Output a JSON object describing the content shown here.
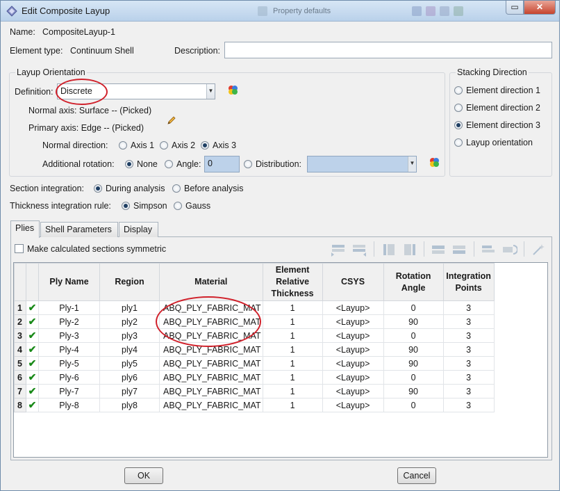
{
  "window": {
    "title": "Edit Composite Layup",
    "background_hint": "Property defaults"
  },
  "name": {
    "label": "Name:",
    "value": "CompositeLayup-1"
  },
  "element_type": {
    "label": "Element type:",
    "value": "Continuum Shell"
  },
  "description": {
    "label": "Description:",
    "value": ""
  },
  "layup_orientation": {
    "title": "Layup Orientation",
    "definition_label": "Definition:",
    "definition_value": "Discrete",
    "normal_axis": "Normal axis: Surface -- (Picked)",
    "primary_axis": "Primary axis: Edge -- (Picked)",
    "normal_direction_label": "Normal direction:",
    "normal_direction_options": [
      "Axis 1",
      "Axis 2",
      "Axis 3"
    ],
    "normal_direction_selected": "Axis 3",
    "additional_rotation_label": "Additional rotation:",
    "rotation_none": "None",
    "rotation_angle": "Angle:",
    "rotation_angle_value": "0",
    "rotation_distribution": "Distribution:"
  },
  "stacking_direction": {
    "title": "Stacking Direction",
    "options": [
      "Element direction 1",
      "Element direction 2",
      "Element direction 3",
      "Layup orientation"
    ],
    "selected": "Element direction 3"
  },
  "section_integration": {
    "label": "Section integration:",
    "during": "During analysis",
    "before": "Before analysis"
  },
  "thickness_rule": {
    "label": "Thickness integration rule:",
    "simpson": "Simpson",
    "gauss": "Gauss"
  },
  "tabs": [
    "Plies",
    "Shell Parameters",
    "Display"
  ],
  "symmetric_label": "Make calculated sections symmetric",
  "table": {
    "headers": {
      "ply_name": "Ply Name",
      "region": "Region",
      "material": "Material",
      "thickness": [
        "Element",
        "Relative",
        "Thickness"
      ],
      "csys": "CSYS",
      "rotation": [
        "Rotation",
        "Angle"
      ],
      "integration": [
        "Integration",
        "Points"
      ]
    },
    "rows": [
      {
        "num": "1",
        "ply": "Ply-1",
        "region": "ply1",
        "material": "ABQ_PLY_FABRIC_MAT",
        "thickness": "1",
        "csys": "<Layup>",
        "angle": "0",
        "points": "3"
      },
      {
        "num": "2",
        "ply": "Ply-2",
        "region": "ply2",
        "material": "ABQ_PLY_FABRIC_MAT",
        "thickness": "1",
        "csys": "<Layup>",
        "angle": "90",
        "points": "3"
      },
      {
        "num": "3",
        "ply": "Ply-3",
        "region": "ply3",
        "material": "ABQ_PLY_FABRIC_MAT",
        "thickness": "1",
        "csys": "<Layup>",
        "angle": "0",
        "points": "3"
      },
      {
        "num": "4",
        "ply": "Ply-4",
        "region": "ply4",
        "material": "ABQ_PLY_FABRIC_MAT",
        "thickness": "1",
        "csys": "<Layup>",
        "angle": "90",
        "points": "3"
      },
      {
        "num": "5",
        "ply": "Ply-5",
        "region": "ply5",
        "material": "ABQ_PLY_FABRIC_MAT",
        "thickness": "1",
        "csys": "<Layup>",
        "angle": "90",
        "points": "3"
      },
      {
        "num": "6",
        "ply": "Ply-6",
        "region": "ply6",
        "material": "ABQ_PLY_FABRIC_MAT",
        "thickness": "1",
        "csys": "<Layup>",
        "angle": "0",
        "points": "3"
      },
      {
        "num": "7",
        "ply": "Ply-7",
        "region": "ply7",
        "material": "ABQ_PLY_FABRIC_MAT",
        "thickness": "1",
        "csys": "<Layup>",
        "angle": "90",
        "points": "3"
      },
      {
        "num": "8",
        "ply": "Ply-8",
        "region": "ply8",
        "material": "ABQ_PLY_FABRIC_MAT",
        "thickness": "1",
        "csys": "<Layup>",
        "angle": "0",
        "points": "3"
      }
    ]
  },
  "buttons": {
    "ok": "OK",
    "cancel": "Cancel"
  },
  "colors": {
    "annotation_red": "#d0202a",
    "check_green": "#1a8a1a",
    "titlebar": "#c8dcf0"
  }
}
